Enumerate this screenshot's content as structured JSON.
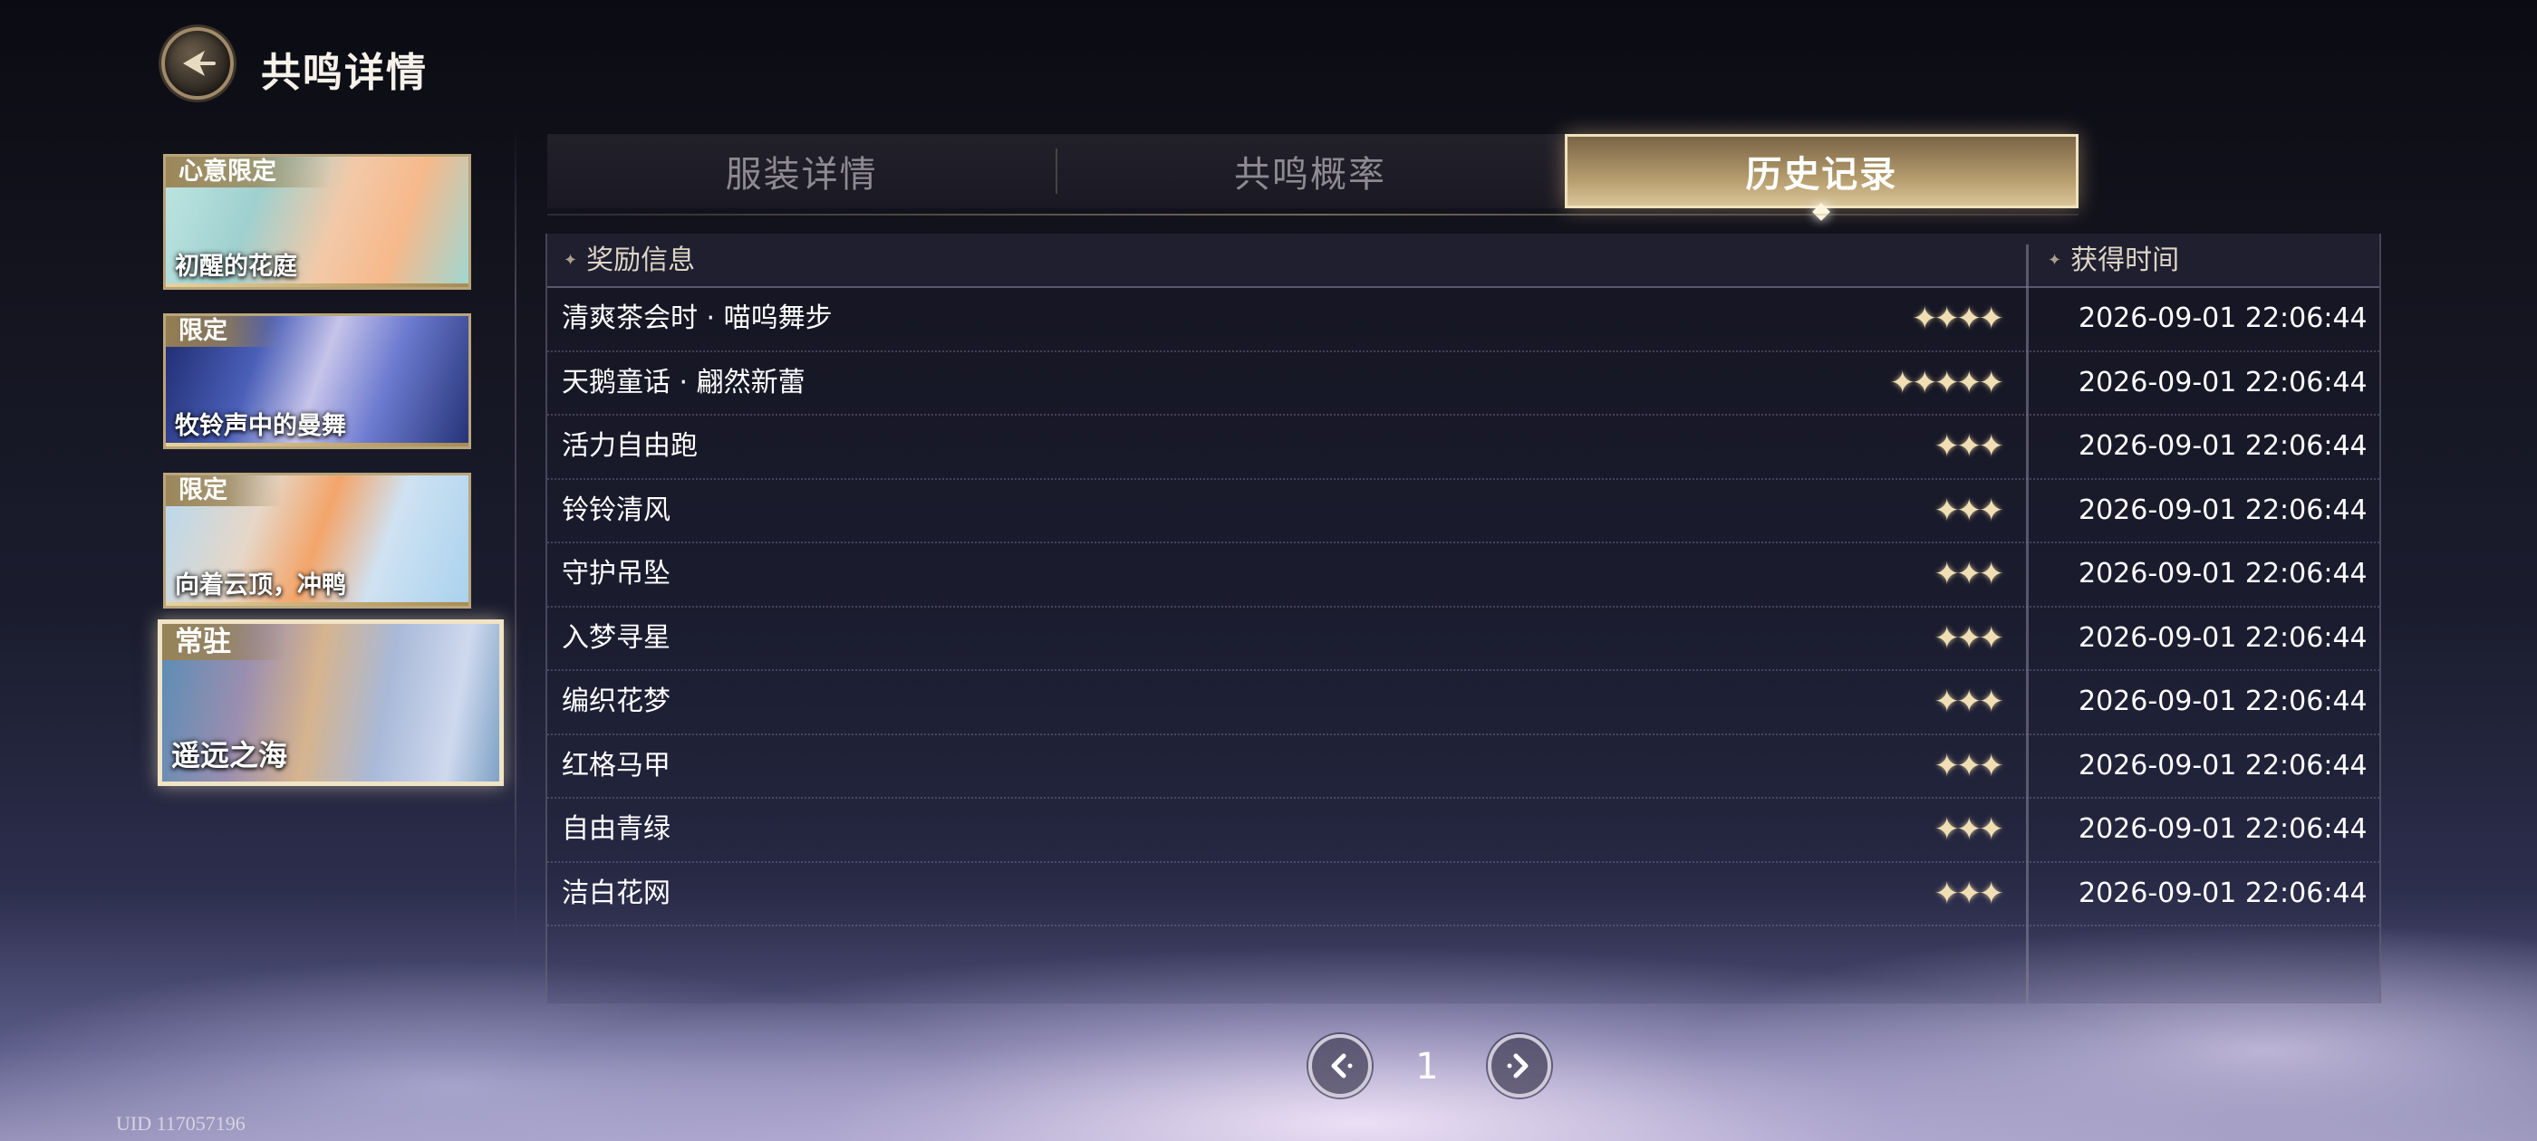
{
  "header": {
    "title": "共鸣详情"
  },
  "banners": [
    {
      "tag": "心意限定",
      "name": "初醒的花庭"
    },
    {
      "tag": "限定",
      "name": "牧铃声中的曼舞"
    },
    {
      "tag": "限定",
      "name": "向着云顶，冲鸭"
    },
    {
      "tag": "常驻",
      "name": "遥远之海"
    }
  ],
  "tabs": [
    {
      "label": "服装详情"
    },
    {
      "label": "共鸣概率"
    },
    {
      "label": "历史记录"
    }
  ],
  "active_tab": "历史记录",
  "table": {
    "headers": {
      "reward": "奖励信息",
      "time": "获得时间"
    },
    "rows": [
      {
        "name": "清爽茶会时 · 喵呜舞步",
        "stars": 4,
        "stars_text": "✦✦✦✦",
        "time": "2026-09-01 22:06:44"
      },
      {
        "name": "天鹅童话 · 翩然新蕾",
        "stars": 5,
        "stars_text": "✦✦✦✦✦",
        "time": "2026-09-01 22:06:44"
      },
      {
        "name": "活力自由跑",
        "stars": 3,
        "stars_text": "✦✦✦",
        "time": "2026-09-01 22:06:44"
      },
      {
        "name": "铃铃清风",
        "stars": 3,
        "stars_text": "✦✦✦",
        "time": "2026-09-01 22:06:44"
      },
      {
        "name": "守护吊坠",
        "stars": 3,
        "stars_text": "✦✦✦",
        "time": "2026-09-01 22:06:44"
      },
      {
        "name": "入梦寻星",
        "stars": 3,
        "stars_text": "✦✦✦",
        "time": "2026-09-01 22:06:44"
      },
      {
        "name": "编织花梦",
        "stars": 3,
        "stars_text": "✦✦✦",
        "time": "2026-09-01 22:06:44"
      },
      {
        "name": "红格马甲",
        "stars": 3,
        "stars_text": "✦✦✦",
        "time": "2026-09-01 22:06:44"
      },
      {
        "name": "自由青绿",
        "stars": 3,
        "stars_text": "✦✦✦",
        "time": "2026-09-01 22:06:44"
      },
      {
        "name": "洁白花网",
        "stars": 3,
        "stars_text": "✦✦✦",
        "time": "2026-09-01 22:06:44"
      }
    ]
  },
  "pagination": {
    "current_page": "1"
  },
  "footer": {
    "uid": "UID 117057196"
  },
  "colors": {
    "accent_gold": "#d9c59a",
    "star": "#f0dfb4"
  }
}
